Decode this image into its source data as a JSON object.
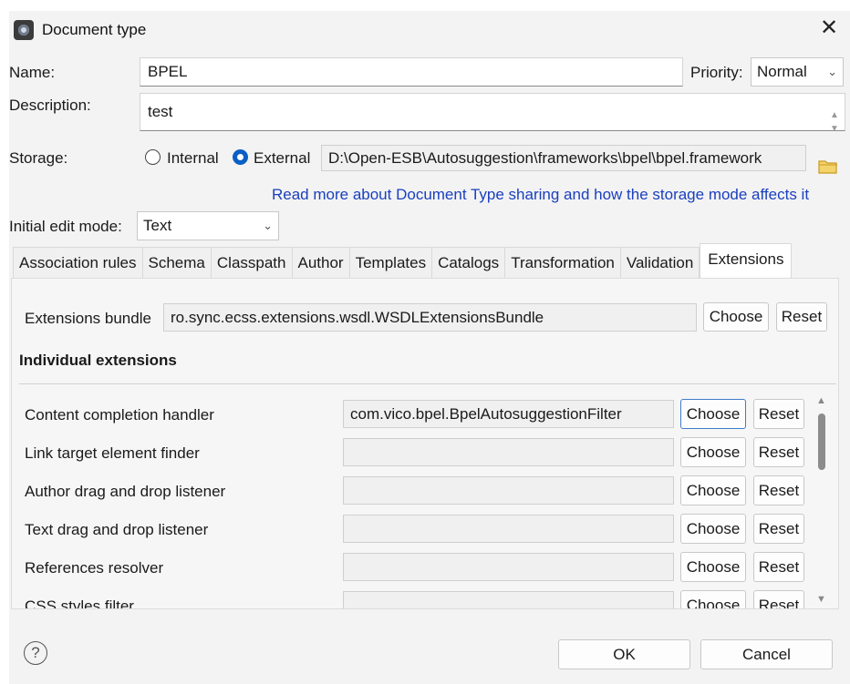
{
  "window": {
    "title": "Document type",
    "icon": "oxygen-app-icon"
  },
  "form": {
    "name_label": "Name:",
    "name_value": "BPEL",
    "priority_label": "Priority:",
    "priority_value": "Normal",
    "description_label": "Description:",
    "description_value": "test",
    "storage_label": "Storage:",
    "storage_internal": "Internal",
    "storage_external": "External",
    "storage_selected": "External",
    "storage_path": "D:\\Open-ESB\\Autosuggestion\\frameworks\\bpel\\bpel.framework",
    "info_link": "Read more about Document Type sharing and how the storage mode affects it",
    "edit_mode_label": "Initial edit mode:",
    "edit_mode_value": "Text"
  },
  "tabs": [
    "Association rules",
    "Schema",
    "Classpath",
    "Author",
    "Templates",
    "Catalogs",
    "Transformation",
    "Validation",
    "Extensions"
  ],
  "active_tab": "Extensions",
  "extensions": {
    "bundle_label": "Extensions bundle",
    "bundle_value": "ro.sync.ecss.extensions.wsdl.WSDLExtensionsBundle",
    "choose_label": "Choose",
    "reset_label": "Reset",
    "section_title": "Individual extensions",
    "rows": [
      {
        "label": "Content completion handler",
        "value": "com.vico.bpel.BpelAutosuggestionFilter"
      },
      {
        "label": "Link target element finder",
        "value": ""
      },
      {
        "label": "Author drag and drop listener",
        "value": ""
      },
      {
        "label": "Text drag and drop listener",
        "value": ""
      },
      {
        "label": "References resolver",
        "value": ""
      },
      {
        "label": "CSS styles filter",
        "value": ""
      }
    ]
  },
  "footer": {
    "ok_label": "OK",
    "cancel_label": "Cancel",
    "help_glyph": "?"
  },
  "colors": {
    "accent": "#0a5fc4",
    "link": "#1a3fbf",
    "dialog_bg": "#f3f3f3"
  }
}
